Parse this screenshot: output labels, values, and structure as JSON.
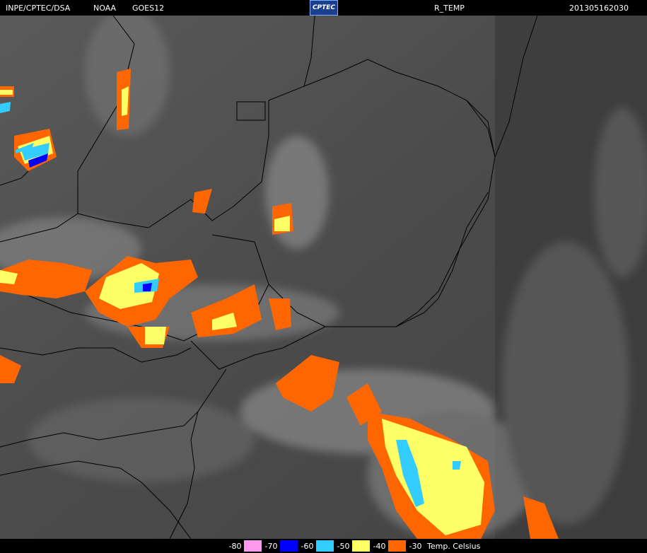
{
  "header": {
    "org": "INPE/CPTEC/DSA",
    "agency": "NOAA",
    "satellite": "GOES12",
    "logo_text": "CPTEC",
    "product": "R_TEMP",
    "timestamp": "201305162030"
  },
  "legend": {
    "unit_label": "Temp. Celsius",
    "entries": [
      {
        "label": "-80",
        "color": "#ff99ee"
      },
      {
        "label": "-70",
        "color": "#ff99ee"
      },
      {
        "label": "-60",
        "color": "#0000ff"
      },
      {
        "label": "-50",
        "color": "#33ccff"
      },
      {
        "label": "-40",
        "color": "#ffff66"
      },
      {
        "label": "-30",
        "color": "#ff6600"
      }
    ]
  },
  "colors": {
    "background": "#000000",
    "land_gray": "#4a4a4a",
    "ocean_gray": "#3c3c3c",
    "cloud_light": "#bdbdbd",
    "border_line": "#000000"
  }
}
